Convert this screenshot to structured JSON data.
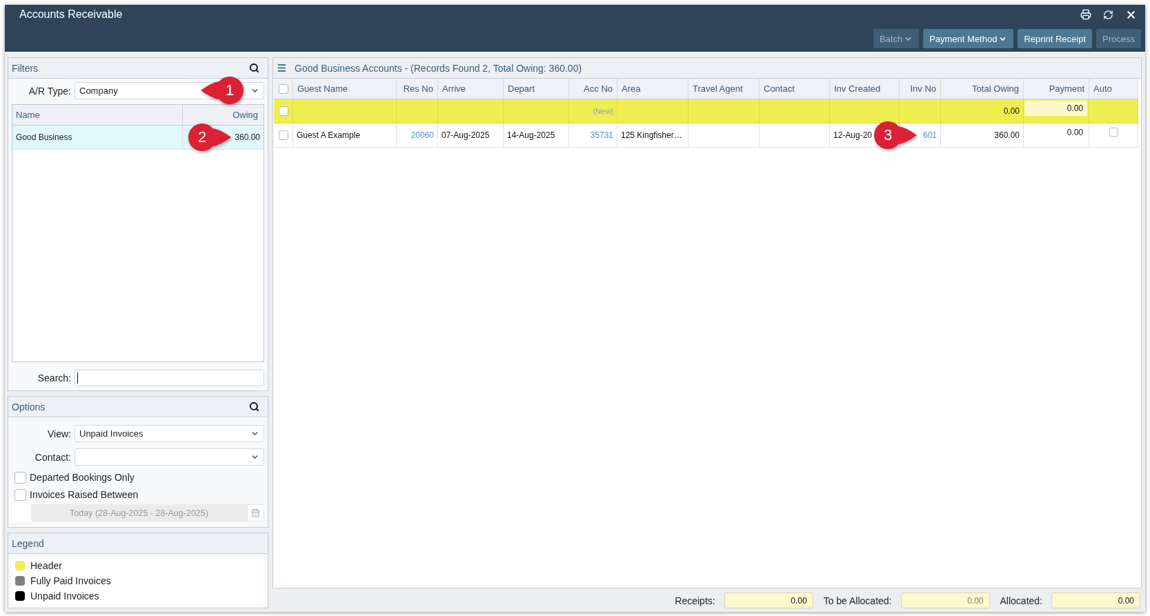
{
  "window": {
    "title": "Accounts Receivable"
  },
  "toolbar": {
    "buttons": [
      {
        "label": "Batch",
        "kind": "dropdown",
        "disabled": true
      },
      {
        "label": "Payment Method",
        "kind": "dropdown",
        "disabled": false
      },
      {
        "label": "Reprint Receipt",
        "kind": "plain",
        "disabled": false
      },
      {
        "label": "Process",
        "kind": "plain",
        "disabled": true
      }
    ]
  },
  "filters": {
    "title": "Filters",
    "ar_type": {
      "label": "A/R Type:",
      "value": "Company",
      "callout": {
        "number": "1",
        "kind": "left"
      }
    },
    "list": {
      "columns": [
        "Name",
        "Owing"
      ],
      "rows": [
        {
          "name": "Good Business",
          "owing": "360.00",
          "selected": true,
          "callout": {
            "number": "2",
            "kind": "right"
          }
        }
      ]
    },
    "search": {
      "label": "Search:",
      "focused": true
    }
  },
  "options": {
    "title": "Options",
    "view": {
      "label": "View:",
      "value": "Unpaid Invoices"
    },
    "contact": {
      "label": "Contact:"
    },
    "checkboxes": [
      {
        "label": "Departed Bookings Only",
        "checked": false
      },
      {
        "label": "Invoices Raised Between",
        "checked": false
      }
    ],
    "date_range": {
      "value": "Today (28-Aug-2025 - 28-Aug-2025)",
      "disabled": true
    }
  },
  "legend": {
    "title": "Legend",
    "items": [
      {
        "label": "Header",
        "color": "#efef50"
      },
      {
        "label": "Fully Paid Invoices",
        "color": "#7f7f7f"
      },
      {
        "label": "Unpaid Invoices",
        "color": "#000000"
      }
    ]
  },
  "accounts": {
    "title": "Good Business Accounts - (Records Found 2, Total Owing: 360.00)",
    "select_all": {
      "checked": false
    },
    "columns": [
      "Guest Name",
      "Res No",
      "Arrive",
      "Depart",
      "Acc No",
      "Area",
      "Travel Agent",
      "Contact",
      "Inv Created",
      "Inv No",
      "Total Owing",
      "Payment",
      "Auto"
    ],
    "rows": [
      {
        "kind": "header",
        "checked": false,
        "cells": [
          {
            "kind": "empty"
          },
          {
            "kind": "empty"
          },
          {
            "kind": "empty"
          },
          {
            "kind": "empty"
          },
          {
            "kind": "link",
            "text": "(New)"
          },
          {
            "kind": "empty"
          },
          {
            "kind": "empty"
          },
          {
            "kind": "empty"
          },
          {
            "kind": "empty"
          },
          {
            "kind": "empty"
          },
          {
            "kind": "text",
            "text": "0.00"
          },
          {
            "kind": "input",
            "value": "0.00"
          },
          {
            "kind": "empty"
          }
        ]
      },
      {
        "kind": "invoice",
        "checked": false,
        "cells": [
          {
            "kind": "text",
            "text": "Guest A Example"
          },
          {
            "kind": "link",
            "text": "20060"
          },
          {
            "kind": "text",
            "text": "07-Aug-2025"
          },
          {
            "kind": "text",
            "text": "14-Aug-2025"
          },
          {
            "kind": "link",
            "text": "35731"
          },
          {
            "kind": "text",
            "text": "125 Kingfisher…"
          },
          {
            "kind": "empty"
          },
          {
            "kind": "empty"
          },
          {
            "kind": "text",
            "text": "12-Aug-20"
          },
          {
            "kind": "link",
            "text": "601",
            "callout": {
              "number": "3",
              "kind": "right"
            }
          },
          {
            "kind": "text",
            "text": "360.00"
          },
          {
            "kind": "input",
            "value": "0.00"
          },
          {
            "kind": "checkbox",
            "checked": false
          }
        ]
      }
    ]
  },
  "totals": [
    {
      "label": "Receipts:",
      "value": "0.00",
      "disabled": false
    },
    {
      "label": "To be Allocated:",
      "value": "0.00",
      "disabled": true
    },
    {
      "label": "Allocated:",
      "value": "0.00",
      "disabled": false
    }
  ]
}
